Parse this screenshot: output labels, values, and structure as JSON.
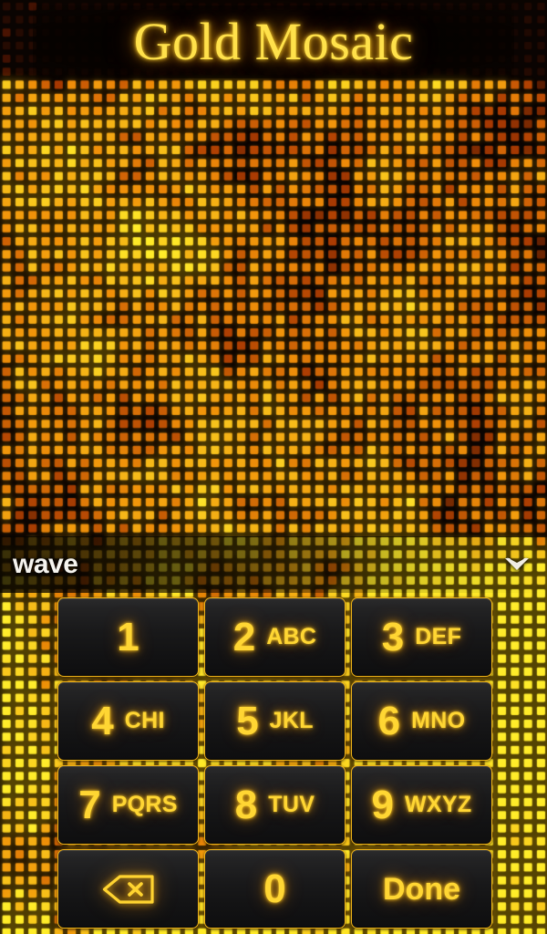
{
  "theme": {
    "name": "Gold Mosaic",
    "accent_gold": "#ffd633",
    "border_gold": "#f0b418",
    "key_dark": "#19191a",
    "background_dark": "#0c0602"
  },
  "header": {
    "title": "Gold Mosaic"
  },
  "input_bar": {
    "composing_text": "wave",
    "hide_keyboard_icon": "chevron-down-icon"
  },
  "keypad": {
    "keys": [
      {
        "digit": "1",
        "letters": "",
        "name": "key-1"
      },
      {
        "digit": "2",
        "letters": "ABC",
        "name": "key-2"
      },
      {
        "digit": "3",
        "letters": "DEF",
        "name": "key-3"
      },
      {
        "digit": "4",
        "letters": "CHI",
        "name": "key-4"
      },
      {
        "digit": "5",
        "letters": "JKL",
        "name": "key-5"
      },
      {
        "digit": "6",
        "letters": "MNO",
        "name": "key-6"
      },
      {
        "digit": "7",
        "letters": "PQRS",
        "name": "key-7"
      },
      {
        "digit": "8",
        "letters": "TUV",
        "name": "key-8"
      },
      {
        "digit": "9",
        "letters": "WXYZ",
        "name": "key-9"
      }
    ],
    "backspace": {
      "icon": "backspace-icon",
      "name": "key-backspace"
    },
    "zero": {
      "digit": "0",
      "name": "key-0"
    },
    "done": {
      "label": "Done",
      "name": "key-done"
    }
  }
}
